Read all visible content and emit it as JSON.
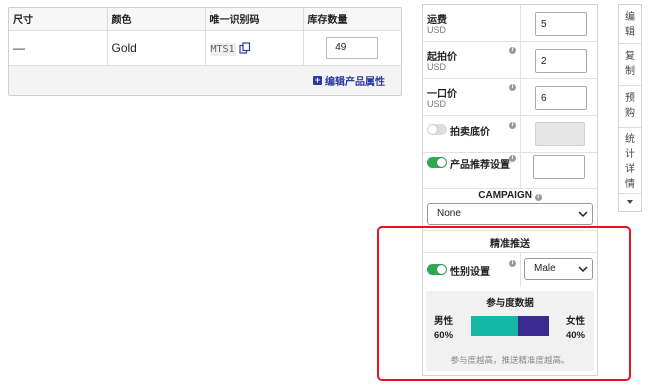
{
  "variants": {
    "columns": [
      "尺寸",
      "颜色",
      "唯一识别码",
      "库存数量"
    ],
    "rows": [
      {
        "size": "—",
        "color": "Gold",
        "sku": "MTS1",
        "qty": "49"
      }
    ],
    "edit_link": "编辑产品属性"
  },
  "settings": {
    "shipping": {
      "label": "运费",
      "currency": "USD",
      "value": "5"
    },
    "starting_price": {
      "label": "起拍价",
      "currency": "USD",
      "value": "2"
    },
    "buy_now": {
      "label": "一口价",
      "currency": "USD",
      "value": "6"
    },
    "reserve": {
      "label": "拍卖底价",
      "enabled": false
    },
    "recommend": {
      "label": "产品推荐设置",
      "enabled": true,
      "value": ""
    },
    "campaign": {
      "label": "CAMPAIGN",
      "selected": "None"
    }
  },
  "targeting": {
    "title": "精准推送",
    "gender": {
      "label": "性别设置",
      "enabled": true,
      "selected": "Male"
    },
    "engagement": {
      "title": "参与度数据",
      "male_label": "男性",
      "male_pct": "60%",
      "male_share": 60,
      "female_label": "女性",
      "female_pct": "40%",
      "female_share": 40,
      "note": "参与度越高，推送精准度越高。"
    }
  },
  "side_tabs": [
    "编辑",
    "复制",
    "预购",
    "统计详情"
  ],
  "colors": {
    "male_bar": "#18b8a6",
    "female_bar": "#3a2a91",
    "toggle_on": "#2fa84f",
    "highlight": "#e8141c",
    "link": "#2b3aa3"
  }
}
